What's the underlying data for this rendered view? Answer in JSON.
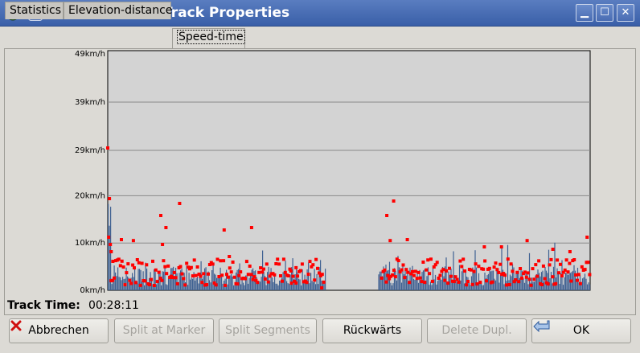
{
  "window": {
    "title": "vlkGPS track - Track Properties",
    "buttons": {
      "minimize": "▁",
      "maximize": "☐",
      "close": "✕"
    }
  },
  "tabs": [
    {
      "label": "Statistics"
    },
    {
      "label": "Elevation-distance"
    },
    {
      "label": "Speed-time",
      "active": true
    }
  ],
  "chart_data": {
    "type": "bar",
    "title": "",
    "xlabel": "",
    "ylabel": "",
    "y_ticks": [
      "49km/h",
      "39km/h",
      "29km/h",
      "20km/h",
      "10km/h",
      "0km/h"
    ],
    "ylim": [
      0,
      49
    ],
    "x_range_minutes": [
      0,
      28.18
    ],
    "grid": true,
    "colors": {
      "bars": "#3f6192",
      "points": "#ff0000",
      "plot_bg": "#d3d3d3"
    },
    "series": [
      {
        "name": "speed",
        "kind": "bars",
        "segments": [
          {
            "t_start": 0.0,
            "t_end": 12.7
          },
          {
            "t_start": 15.8,
            "t_end": 28.18
          }
        ]
      },
      {
        "name": "points",
        "kind": "scatter",
        "points": [
          [
            0.0,
            29.5
          ],
          [
            0.05,
            11.0
          ],
          [
            0.1,
            19.0
          ],
          [
            0.15,
            9.5
          ],
          [
            0.2,
            8.0
          ],
          [
            0.3,
            6.0
          ],
          [
            0.8,
            10.5
          ],
          [
            1.5,
            10.3
          ],
          [
            3.1,
            15.5
          ],
          [
            3.4,
            13.0
          ],
          [
            4.2,
            18.0
          ],
          [
            3.2,
            9.5
          ],
          [
            6.8,
            12.5
          ],
          [
            7.1,
            7.0
          ],
          [
            8.4,
            13.0
          ],
          [
            10.7,
            4.0
          ],
          [
            11.0,
            1.5
          ],
          [
            12.5,
            0.5
          ],
          [
            16.3,
            15.5
          ],
          [
            16.7,
            18.5
          ],
          [
            16.5,
            10.3
          ],
          [
            17.5,
            10.5
          ],
          [
            24.5,
            10.3
          ],
          [
            28.0,
            11.0
          ],
          [
            22.0,
            9.0
          ],
          [
            23.0,
            9.0
          ],
          [
            26.0,
            8.5
          ],
          [
            27.0,
            8.0
          ]
        ]
      }
    ]
  },
  "track_time": {
    "label": "Track Time:",
    "value": "00:28:11"
  },
  "buttons": [
    {
      "label": "Abbrechen",
      "enabled": true,
      "icon": "cancel-icon"
    },
    {
      "label": "Split at Marker",
      "enabled": false
    },
    {
      "label": "Split Segments",
      "enabled": false
    },
    {
      "label": "Rückwärts",
      "enabled": true
    },
    {
      "label": "Delete Dupl.",
      "enabled": false
    },
    {
      "label": "OK",
      "enabled": true,
      "icon": "ok-arrow-icon"
    }
  ]
}
